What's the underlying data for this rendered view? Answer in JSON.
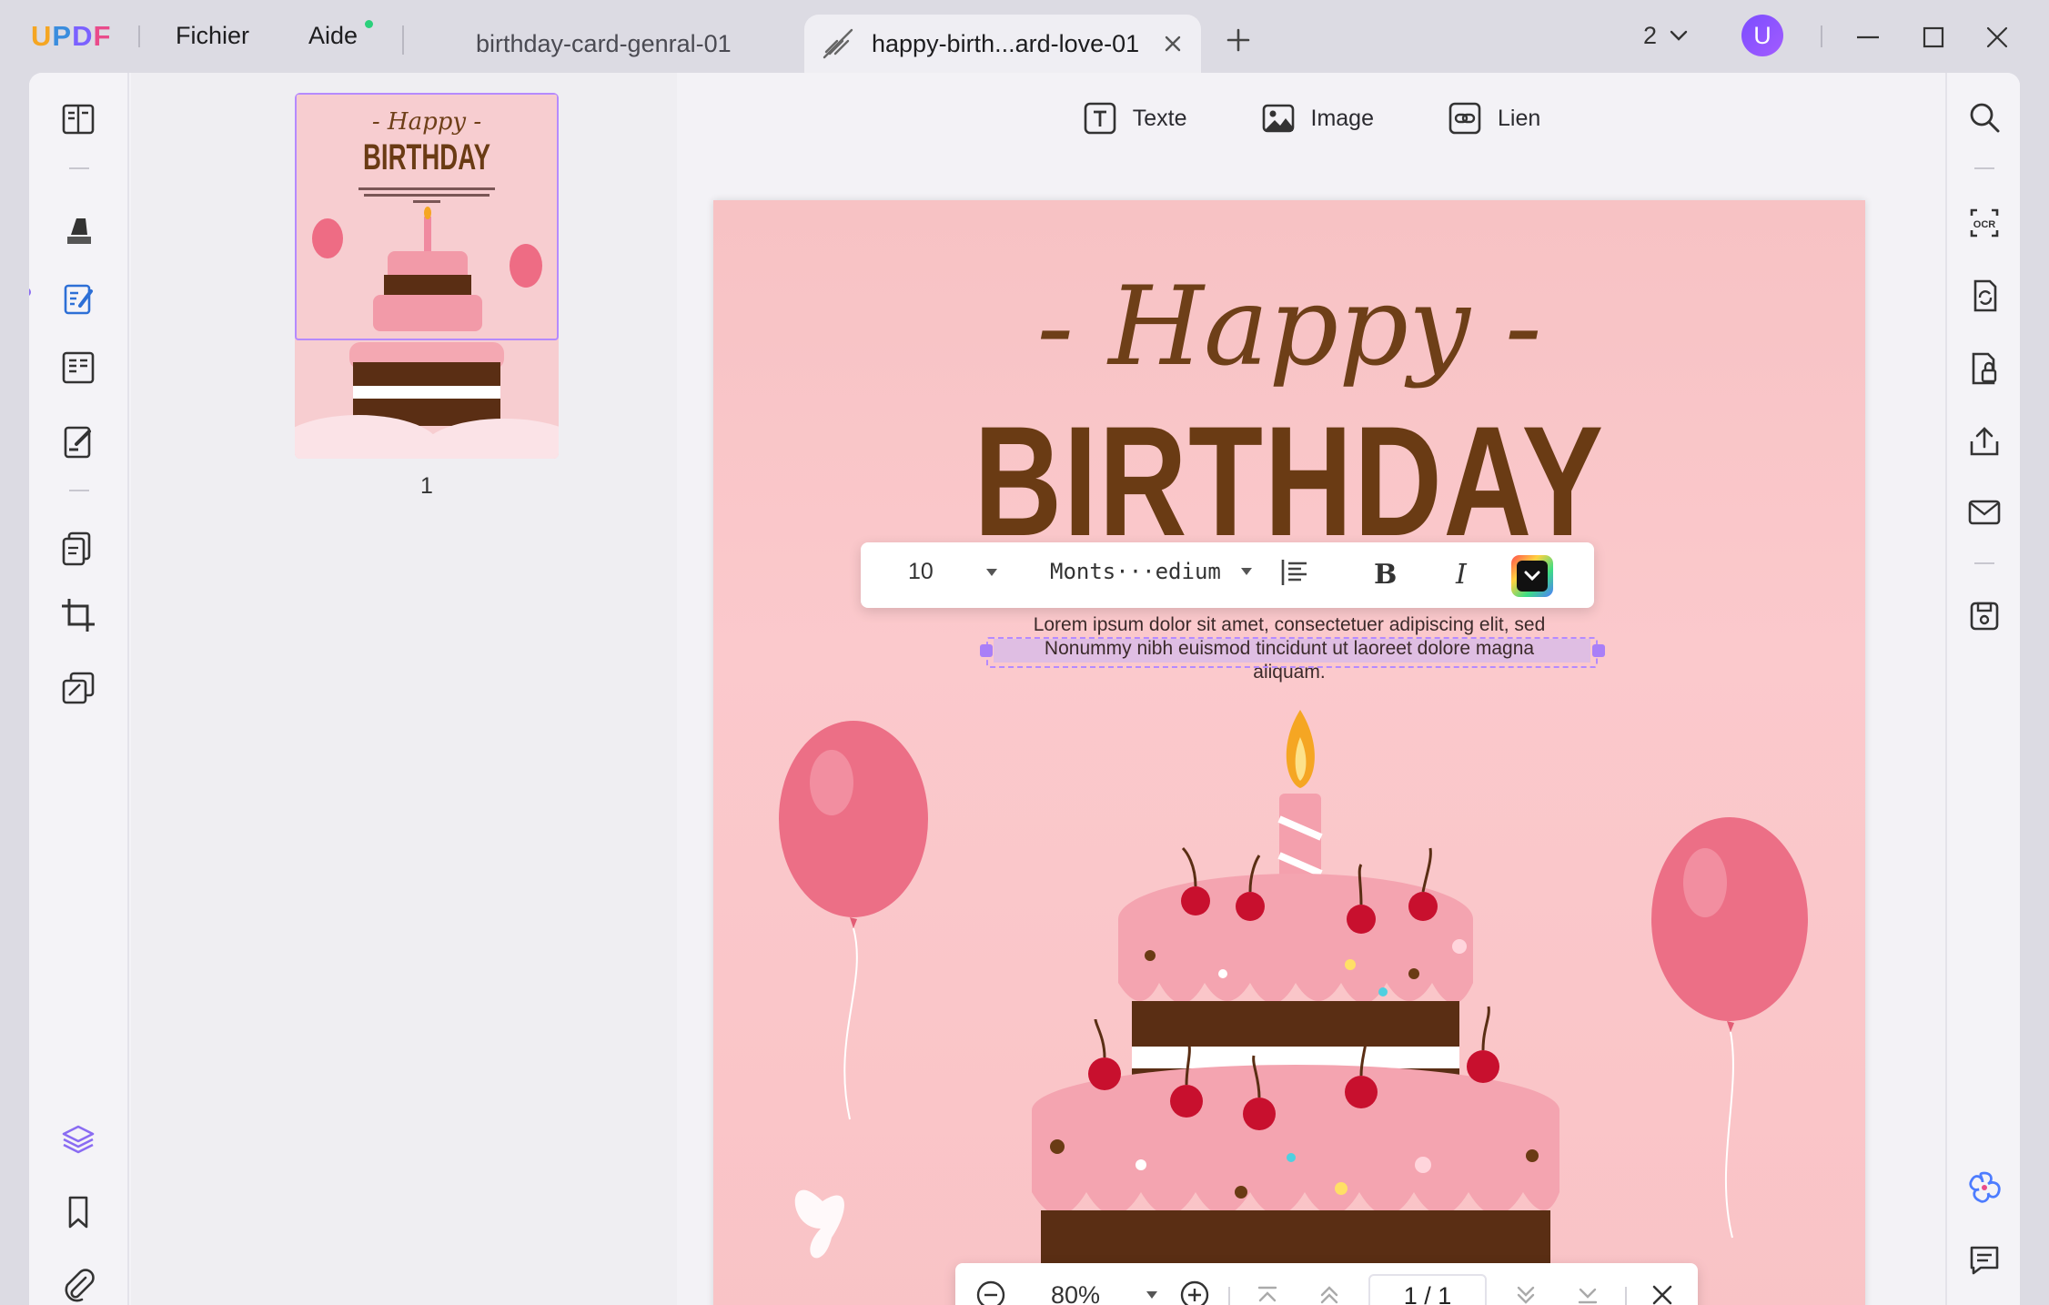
{
  "app": {
    "name": "UPDF",
    "window_count": "2",
    "avatar_initial": "U"
  },
  "menu": {
    "file": "Fichier",
    "help": "Aide"
  },
  "tabs": [
    {
      "label": "birthday-card-genral-01",
      "active": false
    },
    {
      "label": "happy-birth...ard-love-01",
      "active": true
    }
  ],
  "edit_toolbar": {
    "text": "Texte",
    "image": "Image",
    "link": "Lien"
  },
  "thumbnail": {
    "page_number": "1"
  },
  "card": {
    "happy": "- Happy -",
    "birthday": "BIRTHDAY",
    "line1": "Lorem ipsum dolor sit amet, consectetuer adipiscing elit, sed",
    "line2": "Nonummy nibh euismod tincidunt ut laoreet dolore magna",
    "line3": "aliquam."
  },
  "format_bar": {
    "font_size": "10",
    "font_name": "Monts···edium",
    "bold": "B",
    "italic": "I"
  },
  "zoom_bar": {
    "zoom": "80%",
    "page_indicator": "1 / 1"
  },
  "colors": {
    "accent": "#8a6cf2",
    "selection": "#b58aff",
    "page_pink": "#f9c3c6",
    "title_brown": "#6a3b14"
  }
}
